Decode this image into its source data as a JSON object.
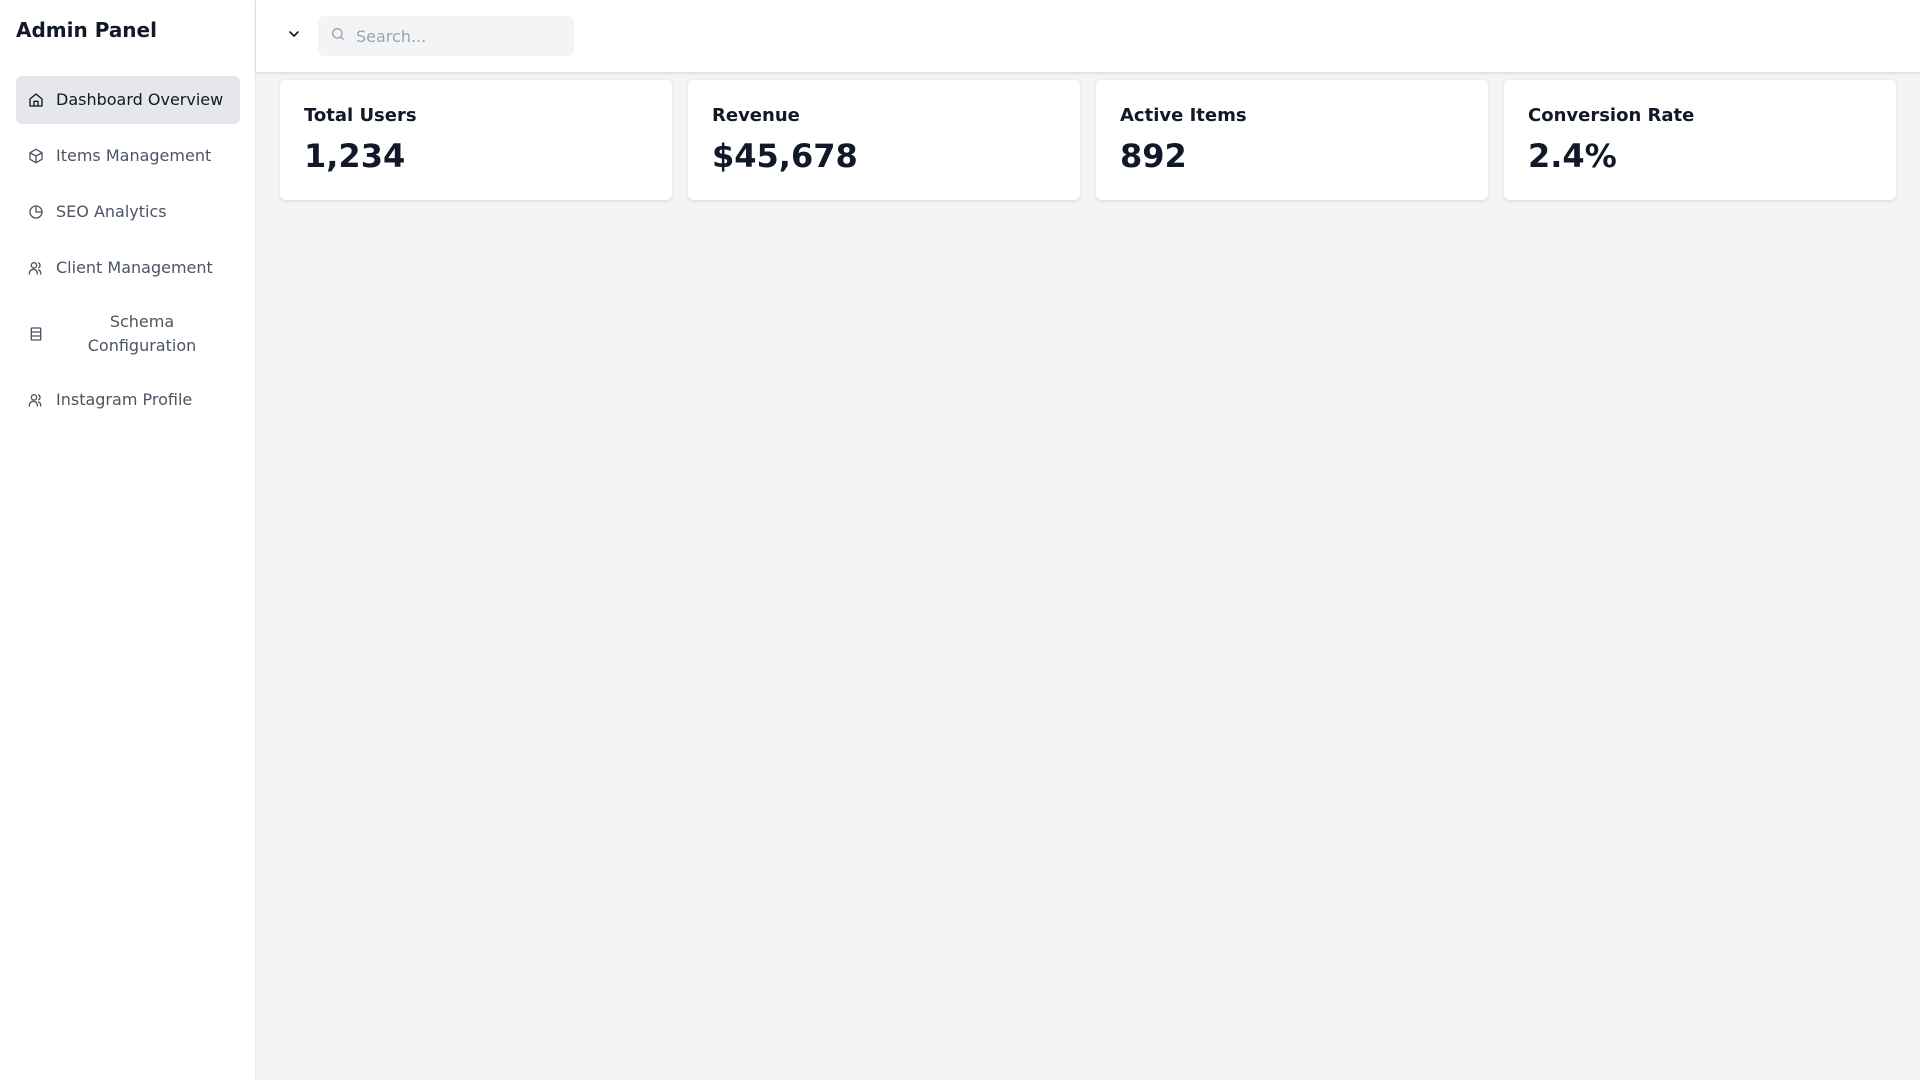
{
  "app": {
    "title": "Admin Panel"
  },
  "sidebar": {
    "items": [
      {
        "label": "Dashboard Overview",
        "icon": "home-icon",
        "active": true
      },
      {
        "label": "Items Management",
        "icon": "package-icon",
        "active": false
      },
      {
        "label": "SEO Analytics",
        "icon": "pie-chart-icon",
        "active": false
      },
      {
        "label": "Client Management",
        "icon": "users-icon",
        "active": false
      },
      {
        "label": "Schema Configuration",
        "icon": "table-icon",
        "active": false
      },
      {
        "label": "Instagram Profile",
        "icon": "users-icon",
        "active": false
      }
    ]
  },
  "topbar": {
    "toggle_icon": "chevron-down-icon",
    "search": {
      "placeholder": "Search...",
      "value": "",
      "icon": "search-icon"
    }
  },
  "stats": [
    {
      "title": "Total Users",
      "value": "1,234"
    },
    {
      "title": "Revenue",
      "value": "$45,678"
    },
    {
      "title": "Active Items",
      "value": "892"
    },
    {
      "title": "Conversion Rate",
      "value": "2.4%"
    }
  ],
  "colors": {
    "background": "#f3f4f6",
    "surface": "#ffffff",
    "text_primary": "#111827",
    "text_secondary": "#4b5563",
    "active_item_bg": "#e5e7eb",
    "placeholder": "#9ca3af"
  }
}
